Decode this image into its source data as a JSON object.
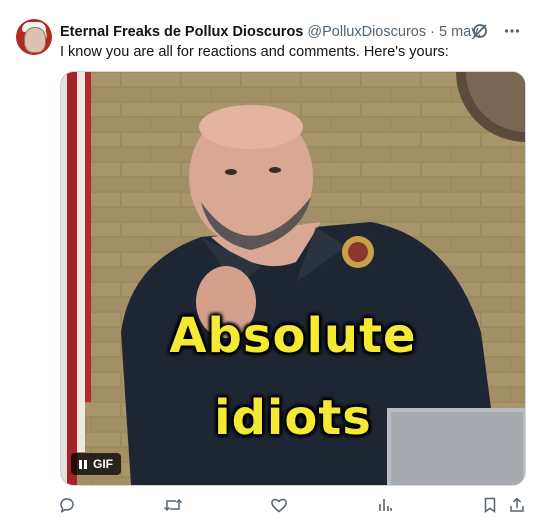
{
  "tweet": {
    "display_name": "Eternal Freaks de Pollux Dioscuros",
    "handle": "@PolluxDioscuros",
    "separator": "·",
    "date": "5 may.",
    "text": "I know you are all for reactions and comments. Here's yours:"
  },
  "media": {
    "caption_line1": "Absolute",
    "caption_line2": "idiots",
    "badge_label": "GIF"
  },
  "icons": {
    "header": [
      "grok-icon",
      "more-icon"
    ],
    "actions": [
      "reply-icon",
      "retweet-icon",
      "like-icon",
      "views-icon",
      "bookmark-icon",
      "share-icon"
    ]
  },
  "colors": {
    "caption": "#f4ea34",
    "secondary_text": "#536471",
    "primary_text": "#0f1419"
  }
}
